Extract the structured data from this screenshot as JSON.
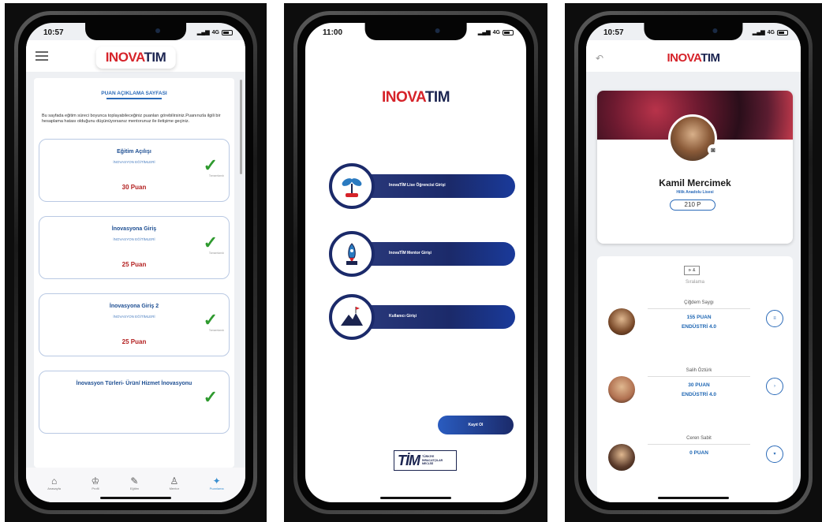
{
  "colors": {
    "brand_red": "#d6232a",
    "brand_navy": "#1b2450",
    "accent_blue": "#2a6ab8",
    "check_green": "#2f9a2f",
    "points_red": "#b32020"
  },
  "screen1": {
    "time": "10:57",
    "network": "4G",
    "logo": {
      "red": "INOVA",
      "navy": "TIM"
    },
    "page_title": "PUAN AÇIKLAMA SAYFASI",
    "description": "Bu sayfada eğitim süreci boyunca toplayabileceğiniz puanları görebilirsiniz.Puanınızla ilgili bir hesaplama hatası olduğunu düşünüyorsanız mentorunuz ile iletişime geçiniz.",
    "cards": [
      {
        "title": "Eğitim Açılışı",
        "subtitle": "İNOVASYON EĞİTİMLERİ",
        "points": "30 Puan",
        "status": "Tamamlandı"
      },
      {
        "title": "İnovasyona Giriş",
        "subtitle": "İNOVASYON EĞİTİMLERİ",
        "points": "25 Puan",
        "status": "Tamamlandı"
      },
      {
        "title": "İnovasyona Giriş 2",
        "subtitle": "İNOVASYON EĞİTİMLERİ",
        "points": "25 Puan",
        "status": "Tamamlandı"
      },
      {
        "title": "İnovasyon Türleri- Ürün/ Hizmet İnovasyonu",
        "subtitle": "",
        "points": "",
        "status": ""
      }
    ],
    "tabs": [
      {
        "label": "Anasayfa",
        "icon": "home-icon",
        "glyph": "⌂"
      },
      {
        "label": "Profil",
        "icon": "crown-icon",
        "glyph": "♔"
      },
      {
        "label": "Eğitim",
        "icon": "training-icon",
        "glyph": "✎"
      },
      {
        "label": "Mentor",
        "icon": "mentor-icon",
        "glyph": "♙"
      },
      {
        "label": "Puanlama",
        "icon": "points-icon",
        "glyph": "✦"
      }
    ]
  },
  "screen2": {
    "time": "11:00",
    "network": "4G",
    "logo": {
      "red": "INOVA",
      "navy": "TIM"
    },
    "roles": [
      {
        "label": "InovaTİM Lise Öğrencisi Girişi",
        "icon": "plant-icon"
      },
      {
        "label": "InovaTİM Mentor Girişi",
        "icon": "rocket-icon"
      },
      {
        "label": "Kullanıcı Girişi",
        "icon": "mountain-flag-icon"
      }
    ],
    "register_label": "Kayıt Ol",
    "tim_logo": {
      "big": "TİM",
      "small": [
        "TÜRKİYE",
        "İHRACATÇILAR",
        "MECLİSİ"
      ]
    }
  },
  "screen3": {
    "time": "10:57",
    "network": "4G",
    "logo": {
      "red": "INOVA",
      "navy": "TIM"
    },
    "profile": {
      "name": "Kamil Mercimek",
      "school": "Hilik Anadolu Lisesi",
      "points": "210 P"
    },
    "sort_button": "⊳ &",
    "sort_label": "Sıralama",
    "users": [
      {
        "name": "Çiğdem Saygı",
        "points": "155 PUAN",
        "group": "ENDÜSTRİ 4.0",
        "action": "≡",
        "avatar_color": "#7a4a2a"
      },
      {
        "name": "Salih Öztürk",
        "points": "30 PUAN",
        "group": "ENDÜSTRİ 4.0",
        "action": "›",
        "avatar_color": "#b07050"
      },
      {
        "name": "Ceren Sabit",
        "points": "0 PUAN",
        "group": "",
        "action": "▾",
        "avatar_color": "#5a3a2a"
      }
    ]
  }
}
